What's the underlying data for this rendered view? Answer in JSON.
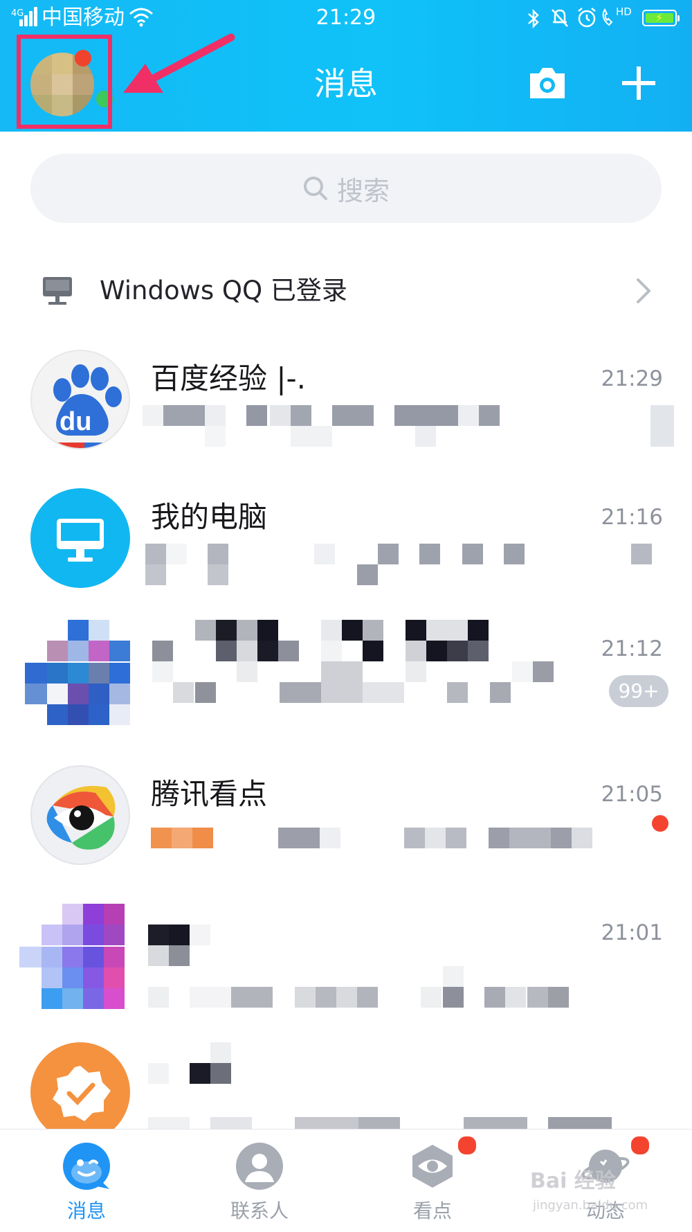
{
  "status_bar": {
    "network_type": "4G",
    "carrier": "中国移动",
    "time": "21:29",
    "hd_label": "HD"
  },
  "header": {
    "title": "消息",
    "camera_icon": "camera-icon",
    "add_icon": "plus-icon",
    "avatar_highlight_color": "#ef2f66",
    "background": "#14b9f5"
  },
  "search": {
    "placeholder": "搜索",
    "icon": "search-icon"
  },
  "pc_login": {
    "label": "Windows QQ 已登录",
    "icon": "monitor-icon"
  },
  "chats": [
    {
      "name": "百度经验 |-.",
      "time": "21:29",
      "avatar_icon": "baidu-paw-icon"
    },
    {
      "name": "我的电脑",
      "time": "21:16",
      "avatar_icon": "computer-icon"
    },
    {
      "name": "",
      "time": "21:12",
      "badge": "99+"
    },
    {
      "name": "腾讯看点",
      "time": "21:05",
      "avatar_icon": "eye-icon",
      "unread_dot": true
    },
    {
      "name": "",
      "time": "21:01"
    },
    {
      "name": "",
      "time": "",
      "avatar_icon": "verified-badge-icon"
    }
  ],
  "tabs": [
    {
      "label": "消息",
      "icon": "qq-penguin-icon",
      "active": true
    },
    {
      "label": "联系人",
      "icon": "contacts-icon",
      "active": false
    },
    {
      "label": "看点",
      "icon": "eye-icon",
      "active": false,
      "dot": true
    },
    {
      "label": "动态",
      "icon": "planet-icon",
      "active": false,
      "dot": true
    }
  ],
  "watermark": {
    "text": "Bai 经验",
    "sub": "jingyan.baidu.com"
  },
  "colors": {
    "accent": "#1f94f5",
    "unread": "#f4442f",
    "online": "#3dc85c"
  }
}
